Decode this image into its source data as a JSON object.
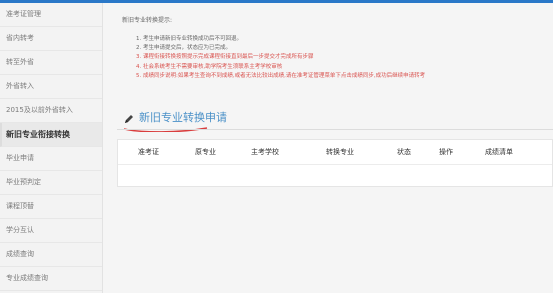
{
  "sidebar": {
    "items": [
      {
        "label": "准考证管理"
      },
      {
        "label": "省内转考"
      },
      {
        "label": "转至外省"
      },
      {
        "label": "外省转入"
      },
      {
        "label": "2015及以前外省转入"
      },
      {
        "label": "新旧专业衔接转换"
      },
      {
        "label": "毕业申请"
      },
      {
        "label": "毕业预判定"
      },
      {
        "label": "课程顶替"
      },
      {
        "label": "学分互认"
      },
      {
        "label": "成绩查询"
      },
      {
        "label": "专业成绩查询"
      }
    ]
  },
  "main": {
    "tips_title": "新旧专业转换提示:",
    "tips": [
      {
        "text": "1. 考生申请新旧专业转换成功后不可回退。"
      },
      {
        "text": "2. 考生申请提交后，状态应为已完成。"
      },
      {
        "text": "3. 课程衔接转换按照提示完成课程衔接直到最后一步提交才完成所有步骤"
      },
      {
        "text": "4. 社会系统考生不需要审核,助学院考生须联系主考学校审核"
      },
      {
        "text": "5. 成绩同步说明:如果考生查询不到成绩,或者无法比较出成绩,请在准考证管理菜单下点击成绩同步,成功后继续申请转考"
      }
    ],
    "section_title": "新旧专业转换申请",
    "table": {
      "columns": [
        "准考证",
        "原专业",
        "主考学校",
        "转换专业",
        "状态",
        "操作",
        "成绩清单"
      ]
    }
  },
  "colors": {
    "accent": "#4b91c8",
    "warning_text": "#d9534f",
    "top_bar": "#2a78c8"
  }
}
